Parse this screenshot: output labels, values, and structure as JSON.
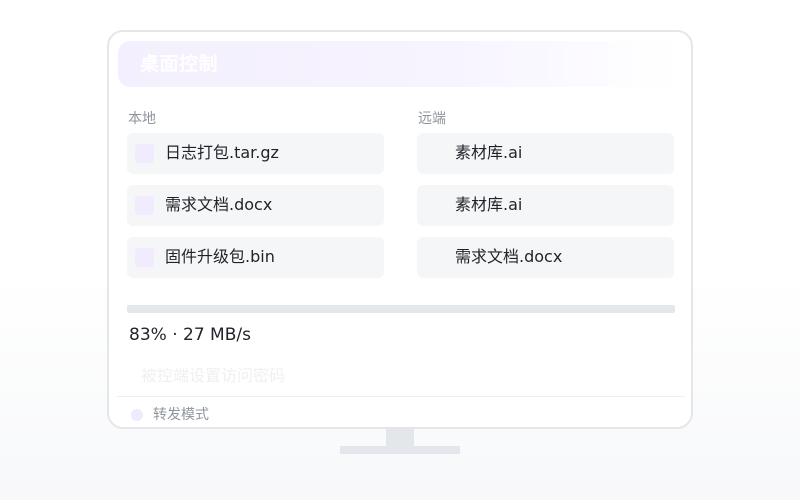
{
  "window": {
    "title": "桌面控制"
  },
  "local": {
    "label": "本地",
    "files": [
      {
        "name": "日志打包.tar.gz"
      },
      {
        "name": "需求文档.docx"
      },
      {
        "name": "固件升级包.bin"
      }
    ]
  },
  "remote": {
    "label": "远端",
    "files": [
      {
        "name": "素材库.ai"
      },
      {
        "name": "素材库.ai"
      },
      {
        "name": "需求文档.docx"
      }
    ]
  },
  "transfer": {
    "percent": 83,
    "status_text": "83% · 27 MB/s"
  },
  "password_hint": "被控端设置访问密码",
  "relay_mode": {
    "label": "转发模式"
  },
  "colors": {
    "accent_light": "#f1ecfd",
    "file_bg": "#f5f6f8",
    "track": "#e4e8ed",
    "border": "#e4e6ea"
  },
  "icons": {
    "local_file": "file-icon",
    "relay_toggle": "radio-dot-icon"
  }
}
